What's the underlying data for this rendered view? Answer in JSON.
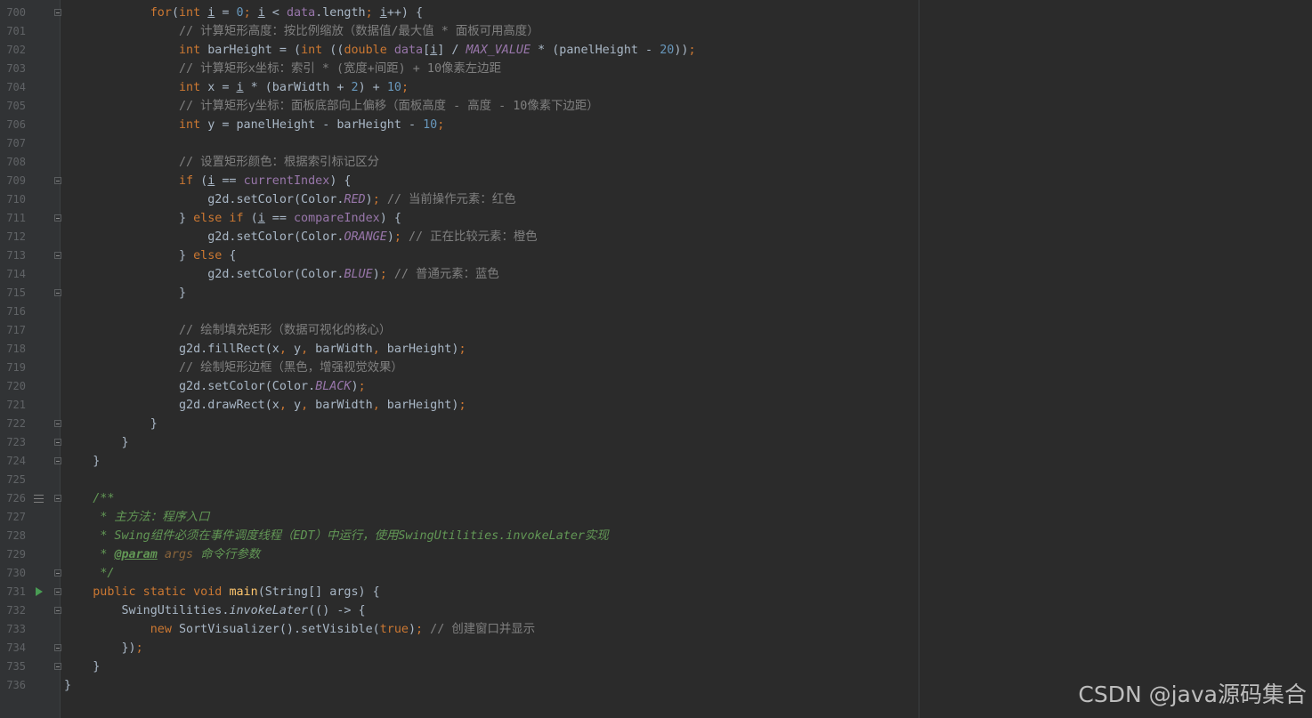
{
  "editor": {
    "language": "java",
    "colors": {
      "background": "#2b2b2b",
      "gutter": "#313335",
      "keyword": "#cc7832",
      "number": "#6897bb",
      "comment": "#808080",
      "doc_comment": "#629755",
      "field": "#9876aa",
      "method_decl": "#ffc66d",
      "text": "#a9b7c6"
    },
    "line_numbers": [
      "700",
      "701",
      "702",
      "703",
      "704",
      "705",
      "706",
      "707",
      "708",
      "709",
      "710",
      "711",
      "712",
      "713",
      "714",
      "715",
      "716",
      "717",
      "718",
      "719",
      "720",
      "721",
      "722",
      "723",
      "724",
      "725",
      "726",
      "727",
      "728",
      "729",
      "730",
      "731",
      "732",
      "733",
      "734",
      "735",
      "736"
    ],
    "lines": [
      {
        "indent": "            ",
        "parts": [
          [
            "kw",
            "for"
          ],
          [
            "",
            "("
          ],
          [
            "kw",
            "int"
          ],
          [
            "",
            " "
          ],
          [
            "ul",
            "i"
          ],
          [
            "",
            " = "
          ],
          [
            "num",
            "0"
          ],
          [
            "kw",
            ";"
          ],
          [
            "",
            " "
          ],
          [
            "ul",
            "i"
          ],
          [
            "",
            " < "
          ],
          [
            "fld",
            "data"
          ],
          [
            "",
            ".length"
          ],
          [
            "kw",
            ";"
          ],
          [
            "",
            " "
          ],
          [
            "ul",
            "i"
          ],
          [
            "",
            "++) {"
          ]
        ]
      },
      {
        "indent": "                ",
        "parts": [
          [
            "cm",
            "// 计算矩形高度：按比例缩放（数据值/最大值 * 面板可用高度）"
          ]
        ]
      },
      {
        "indent": "                ",
        "parts": [
          [
            "kw",
            "int"
          ],
          [
            "",
            " barHeight = ("
          ],
          [
            "kw",
            "int"
          ],
          [
            "",
            " (("
          ],
          [
            "kw",
            "double"
          ],
          [
            "",
            " "
          ],
          [
            "fld",
            "data"
          ],
          [
            "",
            "["
          ],
          [
            "ul",
            "i"
          ],
          [
            "",
            "] / "
          ],
          [
            "cst",
            "MAX_VALUE"
          ],
          [
            "",
            " * (panelHeight - "
          ],
          [
            "num",
            "20"
          ],
          [
            "",
            "))"
          ],
          [
            "kw",
            ";"
          ]
        ]
      },
      {
        "indent": "                ",
        "parts": [
          [
            "cm",
            "// 计算矩形x坐标：索引 * (宽度+间距) + 10像素左边距"
          ]
        ]
      },
      {
        "indent": "                ",
        "parts": [
          [
            "kw",
            "int"
          ],
          [
            "",
            " x = "
          ],
          [
            "ul",
            "i"
          ],
          [
            "",
            " * (barWidth + "
          ],
          [
            "num",
            "2"
          ],
          [
            "",
            ") + "
          ],
          [
            "num",
            "10"
          ],
          [
            "kw",
            ";"
          ]
        ]
      },
      {
        "indent": "                ",
        "parts": [
          [
            "cm",
            "// 计算矩形y坐标：面板底部向上偏移（面板高度 - 高度 - 10像素下边距）"
          ]
        ]
      },
      {
        "indent": "                ",
        "parts": [
          [
            "kw",
            "int"
          ],
          [
            "",
            " y = panelHeight - barHeight - "
          ],
          [
            "num",
            "10"
          ],
          [
            "kw",
            ";"
          ]
        ]
      },
      {
        "indent": "",
        "parts": []
      },
      {
        "indent": "                ",
        "parts": [
          [
            "cm",
            "// 设置矩形颜色：根据索引标记区分"
          ]
        ]
      },
      {
        "indent": "                ",
        "parts": [
          [
            "kw",
            "if"
          ],
          [
            "",
            " ("
          ],
          [
            "ul",
            "i"
          ],
          [
            "",
            " == "
          ],
          [
            "fld",
            "currentIndex"
          ],
          [
            "",
            ") {"
          ]
        ]
      },
      {
        "indent": "                    ",
        "parts": [
          [
            "",
            "g2d.setColor(Color."
          ],
          [
            "cst",
            "RED"
          ],
          [
            "",
            ")"
          ],
          [
            "kw",
            ";"
          ],
          [
            "",
            " "
          ],
          [
            "cm",
            "// 当前操作元素：红色"
          ]
        ]
      },
      {
        "indent": "                ",
        "parts": [
          [
            "",
            "} "
          ],
          [
            "kw",
            "else if"
          ],
          [
            "",
            " ("
          ],
          [
            "ul",
            "i"
          ],
          [
            "",
            " == "
          ],
          [
            "fld",
            "compareIndex"
          ],
          [
            "",
            ") {"
          ]
        ]
      },
      {
        "indent": "                    ",
        "parts": [
          [
            "",
            "g2d.setColor(Color."
          ],
          [
            "cst",
            "ORANGE"
          ],
          [
            "",
            ")"
          ],
          [
            "kw",
            ";"
          ],
          [
            "",
            " "
          ],
          [
            "cm",
            "// 正在比较元素：橙色"
          ]
        ]
      },
      {
        "indent": "                ",
        "parts": [
          [
            "",
            "} "
          ],
          [
            "kw",
            "else"
          ],
          [
            "",
            " {"
          ]
        ]
      },
      {
        "indent": "                    ",
        "parts": [
          [
            "",
            "g2d.setColor(Color."
          ],
          [
            "cst",
            "BLUE"
          ],
          [
            "",
            ")"
          ],
          [
            "kw",
            ";"
          ],
          [
            "",
            " "
          ],
          [
            "cm",
            "// 普通元素：蓝色"
          ]
        ]
      },
      {
        "indent": "                ",
        "parts": [
          [
            "",
            "}"
          ]
        ]
      },
      {
        "indent": "",
        "parts": []
      },
      {
        "indent": "                ",
        "parts": [
          [
            "cm",
            "// 绘制填充矩形（数据可视化的核心）"
          ]
        ]
      },
      {
        "indent": "                ",
        "parts": [
          [
            "",
            "g2d.fillRect(x"
          ],
          [
            "kw",
            ","
          ],
          [
            "",
            " y"
          ],
          [
            "kw",
            ","
          ],
          [
            "",
            " barWidth"
          ],
          [
            "kw",
            ","
          ],
          [
            "",
            " barHeight)"
          ],
          [
            "kw",
            ";"
          ]
        ]
      },
      {
        "indent": "                ",
        "parts": [
          [
            "cm",
            "// 绘制矩形边框（黑色，增强视觉效果）"
          ]
        ]
      },
      {
        "indent": "                ",
        "parts": [
          [
            "",
            "g2d.setColor(Color."
          ],
          [
            "cst",
            "BLACK"
          ],
          [
            "",
            ")"
          ],
          [
            "kw",
            ";"
          ]
        ]
      },
      {
        "indent": "                ",
        "parts": [
          [
            "",
            "g2d.drawRect(x"
          ],
          [
            "kw",
            ","
          ],
          [
            "",
            " y"
          ],
          [
            "kw",
            ","
          ],
          [
            "",
            " barWidth"
          ],
          [
            "kw",
            ","
          ],
          [
            "",
            " barHeight)"
          ],
          [
            "kw",
            ";"
          ]
        ]
      },
      {
        "indent": "            ",
        "parts": [
          [
            "",
            "}"
          ]
        ]
      },
      {
        "indent": "        ",
        "parts": [
          [
            "",
            "}"
          ]
        ]
      },
      {
        "indent": "    ",
        "parts": [
          [
            "",
            "}"
          ]
        ]
      },
      {
        "indent": "",
        "parts": []
      },
      {
        "indent": "    ",
        "parts": [
          [
            "doc",
            "/**"
          ]
        ]
      },
      {
        "indent": "     ",
        "parts": [
          [
            "doc",
            "* 主方法：程序入口"
          ]
        ]
      },
      {
        "indent": "     ",
        "parts": [
          [
            "doc",
            "* Swing组件必须在事件调度线程（EDT）中运行，使用SwingUtilities.invokeLater实现"
          ]
        ]
      },
      {
        "indent": "     ",
        "parts": [
          [
            "doc",
            "* "
          ],
          [
            "tag",
            "@param"
          ],
          [
            "doc",
            " "
          ],
          [
            "docparam",
            "args"
          ],
          [
            "doc",
            " 命令行参数"
          ]
        ]
      },
      {
        "indent": "     ",
        "parts": [
          [
            "doc",
            "*/"
          ]
        ]
      },
      {
        "indent": "    ",
        "parts": [
          [
            "kw",
            "public static void"
          ],
          [
            "",
            " "
          ],
          [
            "mth",
            "main"
          ],
          [
            "",
            "(String[] args) {"
          ]
        ]
      },
      {
        "indent": "        ",
        "parts": [
          [
            "",
            "SwingUtilities."
          ],
          [
            "ital",
            "invokeLater"
          ],
          [
            "",
            "(() -> {"
          ]
        ]
      },
      {
        "indent": "            ",
        "parts": [
          [
            "kw",
            "new"
          ],
          [
            "",
            " SortVisualizer().setVisible("
          ],
          [
            "kw",
            "true"
          ],
          [
            "",
            ")"
          ],
          [
            "kw",
            ";"
          ],
          [
            "",
            " "
          ],
          [
            "cm",
            "// 创建窗口并显示"
          ]
        ]
      },
      {
        "indent": "        ",
        "parts": [
          [
            "",
            "})"
          ],
          [
            "kw",
            ";"
          ]
        ]
      },
      {
        "indent": "    ",
        "parts": [
          [
            "",
            "}"
          ]
        ]
      },
      {
        "indent": "",
        "parts": [
          [
            "",
            "}"
          ]
        ]
      }
    ],
    "fold_markers": [
      0,
      9,
      11,
      13,
      15,
      22,
      23,
      24,
      26,
      30,
      31,
      32,
      34,
      35
    ],
    "run_marker_line": 31,
    "doc_marker_line": 26
  },
  "watermark": "CSDN @java源码集合"
}
